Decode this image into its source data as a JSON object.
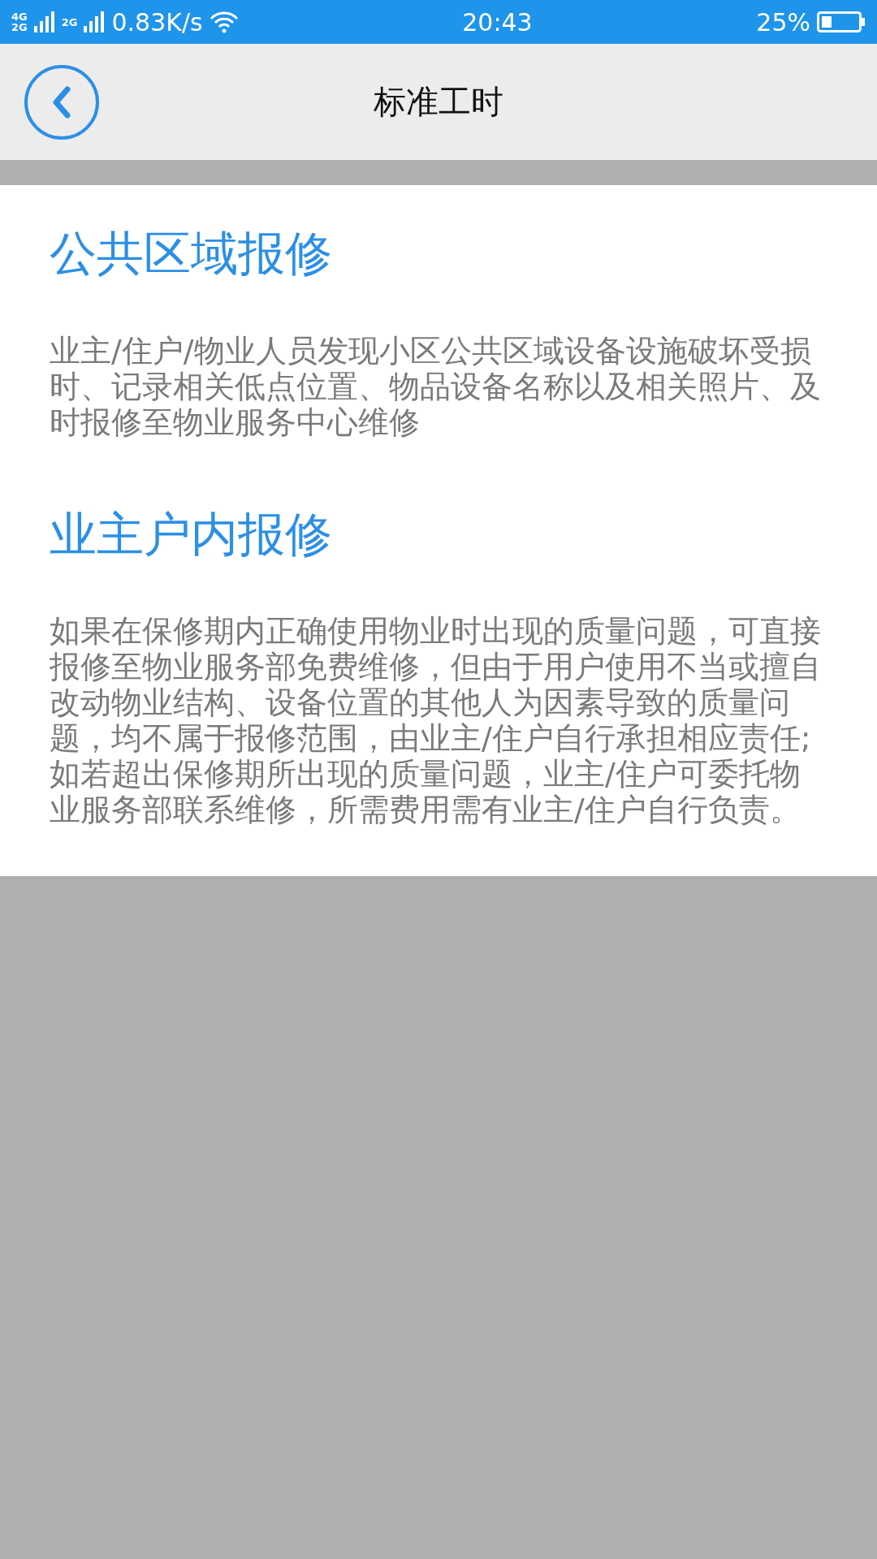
{
  "status_bar": {
    "network_top": "4G",
    "network_bottom": "2G",
    "network_2": "2G",
    "speed": "0.83K/s",
    "time": "20:43",
    "battery": "25%"
  },
  "header": {
    "title": "标准工时"
  },
  "sections": [
    {
      "heading": "公共区域报修",
      "body": "业主/住户/物业人员发现小区公共区域设备设施破坏受损时、记录相关低点位置、物品设备名称以及相关照片、及时报修至物业服务中心维修"
    },
    {
      "heading": "业主户内报修",
      "body": "如果在保修期内正确使用物业时出现的质量问题，可直接报修至物业服务部免费维修，但由于用户使用不当或擅自改动物业结构、设备位置的其他人为因素导致的质量问题，均不属于报修范围，由业主/住户自行承担相应责任;如若超出保修期所出现的质量问题，业主/住户可委托物业服务部联系维修，所需费用需有业主/住户自行负责。"
    }
  ]
}
